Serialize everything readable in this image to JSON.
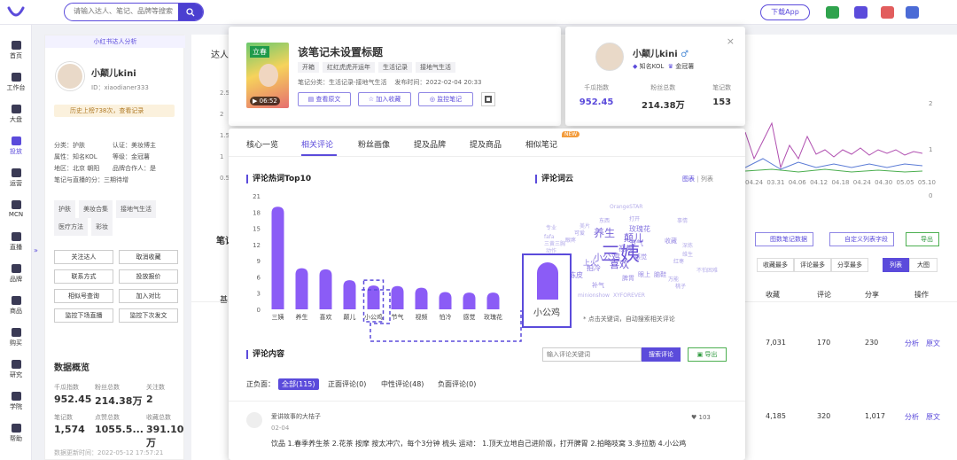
{
  "topbar": {
    "search_placeholder": "请输入达人、笔记、品牌等搜索",
    "download": "下载App"
  },
  "nav": [
    "首页",
    "工作台",
    "大盘",
    "投放",
    "运营",
    "MCN",
    "直播",
    "品牌",
    "商品",
    "购买",
    "研究",
    "学院",
    "帮助"
  ],
  "profile": {
    "header": "小红书达人分析",
    "name": "小颠儿kini",
    "id": "ID：xiaodianer333",
    "history": "历史上榜738次，查看记录",
    "info": [
      [
        "分类：护肤",
        "认证：美妆博主"
      ],
      [
        "属性：知名KOL",
        "等级：金冠薯"
      ],
      [
        "地区：北京 朝阳",
        "品牌合作人：是"
      ],
      [
        "笔记与直播的分：三期待增",
        ""
      ]
    ],
    "tags": [
      "护肤",
      "美妆合集",
      "接地气生活",
      "医疗方法",
      "彩妆"
    ],
    "actions": [
      "关注达人",
      "取消收藏",
      "联系方式",
      "投放报价",
      "相似号查询",
      "加入对比",
      "监控下场直播",
      "监控下次发文"
    ],
    "overview_title": "数据概览",
    "stats": [
      [
        "千瓜指数",
        "952.45"
      ],
      [
        "粉丝总数",
        "214.38万"
      ],
      [
        "关注数",
        "2"
      ],
      [
        "笔记数",
        "1,574"
      ],
      [
        "点赞总数",
        "1055.5..."
      ],
      [
        "收藏总数",
        "391.10万"
      ]
    ],
    "footer": "数据更新时间：2022-05-12 17:57:21"
  },
  "background": {
    "label_daren": "达人",
    "label_notes": "笔记",
    "axis_left": [
      "2.5",
      "2",
      "1.5",
      "1",
      "0.5",
      "0"
    ],
    "axis_right": [
      "2",
      "1",
      "0"
    ],
    "dates": [
      "04.24",
      "03.31",
      "04.06",
      "04.12",
      "04.18",
      "04.24",
      "04.30",
      "05.05",
      "05.10"
    ],
    "btns": [
      "图数笔记数据",
      "自定义列表字段",
      "导出"
    ],
    "sort_btns": [
      "收藏最多",
      "评论最多",
      "分享最多",
      "列表",
      "大图"
    ],
    "cols": [
      "收藏",
      "评论",
      "分享",
      "操作"
    ],
    "rows": [
      [
        "7,031",
        "170",
        "230",
        "分析",
        "原文"
      ],
      [
        "4,185",
        "320",
        "1,017",
        "分析",
        "原文"
      ]
    ],
    "basic": "基"
  },
  "note": {
    "title": "该笔记未设置标题",
    "thumb_time": "06:52",
    "thumb_caption": "立春",
    "tags": [
      "开箱",
      "红红虎虎开运年",
      "生活记录",
      "接地气生活"
    ],
    "meta": "笔记分类：生活记录-接地气生活    发布时间：2022-02-04 20:33",
    "buttons": [
      "查看原文",
      "加入收藏",
      "监控笔记"
    ]
  },
  "author": {
    "name": "小颠儿kini",
    "gender": "♂",
    "kol": "知名KOL",
    "level": "金冠薯",
    "stats": [
      [
        "千瓜指数",
        "952.45"
      ],
      [
        "粉丝总数",
        "214.38万"
      ],
      [
        "笔记数",
        "153"
      ]
    ]
  },
  "tabs": [
    "核心一览",
    "相关评论",
    "粉丝画像",
    "提及品牌",
    "提及商品",
    "相似笔记"
  ],
  "new_badge": "NEW",
  "hot": {
    "title": "评论热词Top10",
    "chart_data": {
      "type": "bar",
      "categories": [
        "三姨",
        "养生",
        "喜欢",
        "颠儿",
        "小公鸡",
        "节气",
        "视频",
        "怕冷",
        "感觉",
        "玫瑰花"
      ],
      "values": [
        19,
        7.6,
        7.4,
        5.4,
        4.4,
        4.3,
        4,
        3.2,
        3.1,
        3.1
      ],
      "ylim": [
        0,
        21
      ],
      "yticks": [
        0,
        3,
        6,
        9,
        12,
        15,
        18,
        21
      ],
      "highlight": "小公鸡"
    },
    "highlight_label": "小公鸡"
  },
  "cloud": {
    "title": "评论词云",
    "view_chart": "图表",
    "view_list": "列表",
    "note": "* 点击关键词，自动搜索相关评论",
    "words": [
      {
        "t": "三姨",
        "s": 22,
        "c": "#6a52d6"
      },
      {
        "t": "养生",
        "s": 12,
        "c": "#7a66da"
      },
      {
        "t": "颠儿",
        "s": 11,
        "c": "#6a52d6"
      },
      {
        "t": "小公鸡",
        "s": 10,
        "c": "#7a66da"
      },
      {
        "t": "喜欢",
        "s": 11,
        "c": "#6a52d6"
      },
      {
        "t": "视频",
        "s": 8,
        "c": "#8878e0"
      },
      {
        "t": "玫瑰花",
        "s": 8,
        "c": "#8878e0"
      },
      {
        "t": "节气",
        "s": 8,
        "c": "#8878e0"
      },
      {
        "t": "上火",
        "s": 8,
        "c": "#8878e0"
      },
      {
        "t": "拍冷",
        "s": 8,
        "c": "#8878e0"
      },
      {
        "t": "陈皮",
        "s": 8,
        "c": "#8878e0"
      },
      {
        "t": "感觉",
        "s": 7,
        "c": "#9a8ce4"
      },
      {
        "t": "补气",
        "s": 7,
        "c": "#9a8ce4"
      },
      {
        "t": "脾胃",
        "s": 7,
        "c": "#9a8ce4"
      },
      {
        "t": "眼上",
        "s": 7,
        "c": "#9a8ce4"
      },
      {
        "t": "脑鞋",
        "s": 7,
        "c": "#9a8ce4"
      },
      {
        "t": "收藏",
        "s": 7,
        "c": "#9a8ce4"
      },
      {
        "t": "可爱",
        "s": 6,
        "c": "#aaa0e8"
      },
      {
        "t": "东西",
        "s": 6,
        "c": "#aaa0e8"
      },
      {
        "t": "打开",
        "s": 6,
        "c": "#aaa0e8"
      },
      {
        "t": "OrangeSTAR",
        "s": 6,
        "c": "#b6aeea"
      },
      {
        "t": "XYFOREVER",
        "s": 6,
        "c": "#b6aeea"
      },
      {
        "t": "minionshow",
        "s": 6,
        "c": "#b6aeea"
      },
      {
        "t": "fafa",
        "s": 6,
        "c": "#b6aeea"
      },
      {
        "t": "眼疼",
        "s": 6,
        "c": "#aaa0e8"
      },
      {
        "t": "红枣",
        "s": 6,
        "c": "#aaa0e8"
      },
      {
        "t": "桃子",
        "s": 6,
        "c": "#aaa0e8"
      },
      {
        "t": "万能",
        "s": 6,
        "c": "#aaa0e8"
      },
      {
        "t": "事情",
        "s": 6,
        "c": "#b6aeea"
      },
      {
        "t": "不怕困难",
        "s": 6,
        "c": "#b6aeea"
      },
      {
        "t": "专业",
        "s": 6,
        "c": "#b6aeea"
      },
      {
        "t": "动作",
        "s": 6,
        "c": "#b6aeea"
      },
      {
        "t": "三黄三胸",
        "s": 6,
        "c": "#b6aeea"
      },
      {
        "t": "美片",
        "s": 6,
        "c": "#b6aeea"
      },
      {
        "t": "黄芪",
        "s": 6,
        "c": "#b6aeea"
      },
      {
        "t": "年轻",
        "s": 6,
        "c": "#b6aeea"
      },
      {
        "t": "完美",
        "s": 6,
        "c": "#b6aeea"
      },
      {
        "t": "深炼",
        "s": 6,
        "c": "#b6aeea"
      },
      {
        "t": "维生",
        "s": 6,
        "c": "#b6aeea"
      },
      {
        "t": "姨母",
        "s": 6,
        "c": "#b6aeea"
      }
    ]
  },
  "comments": {
    "title": "评论内容",
    "search_placeholder": "输入评论关键词",
    "search_btn": "搜索评论",
    "export": "导出",
    "filter_label": "正负面：",
    "filters": [
      "全部(115)",
      "正面评论(0)",
      "中性评论(48)",
      "负面评论(0)"
    ],
    "item": {
      "user": "爱讲故事的大桔子",
      "date": "02-04",
      "likes": "103",
      "text": "饮品 1.春季养生茶 2.花茶 按摩 按太冲穴，每个3分钟 梳头 运动： 1.顶天立地自己进阶版，打开脾胃 2.拍略吱窝 3.多拉筋 4.小公鸡"
    }
  },
  "colors": {
    "accent": "#5b4bdb",
    "bar": "#8b5cf6",
    "highlight_border": "#5b4bdb"
  }
}
